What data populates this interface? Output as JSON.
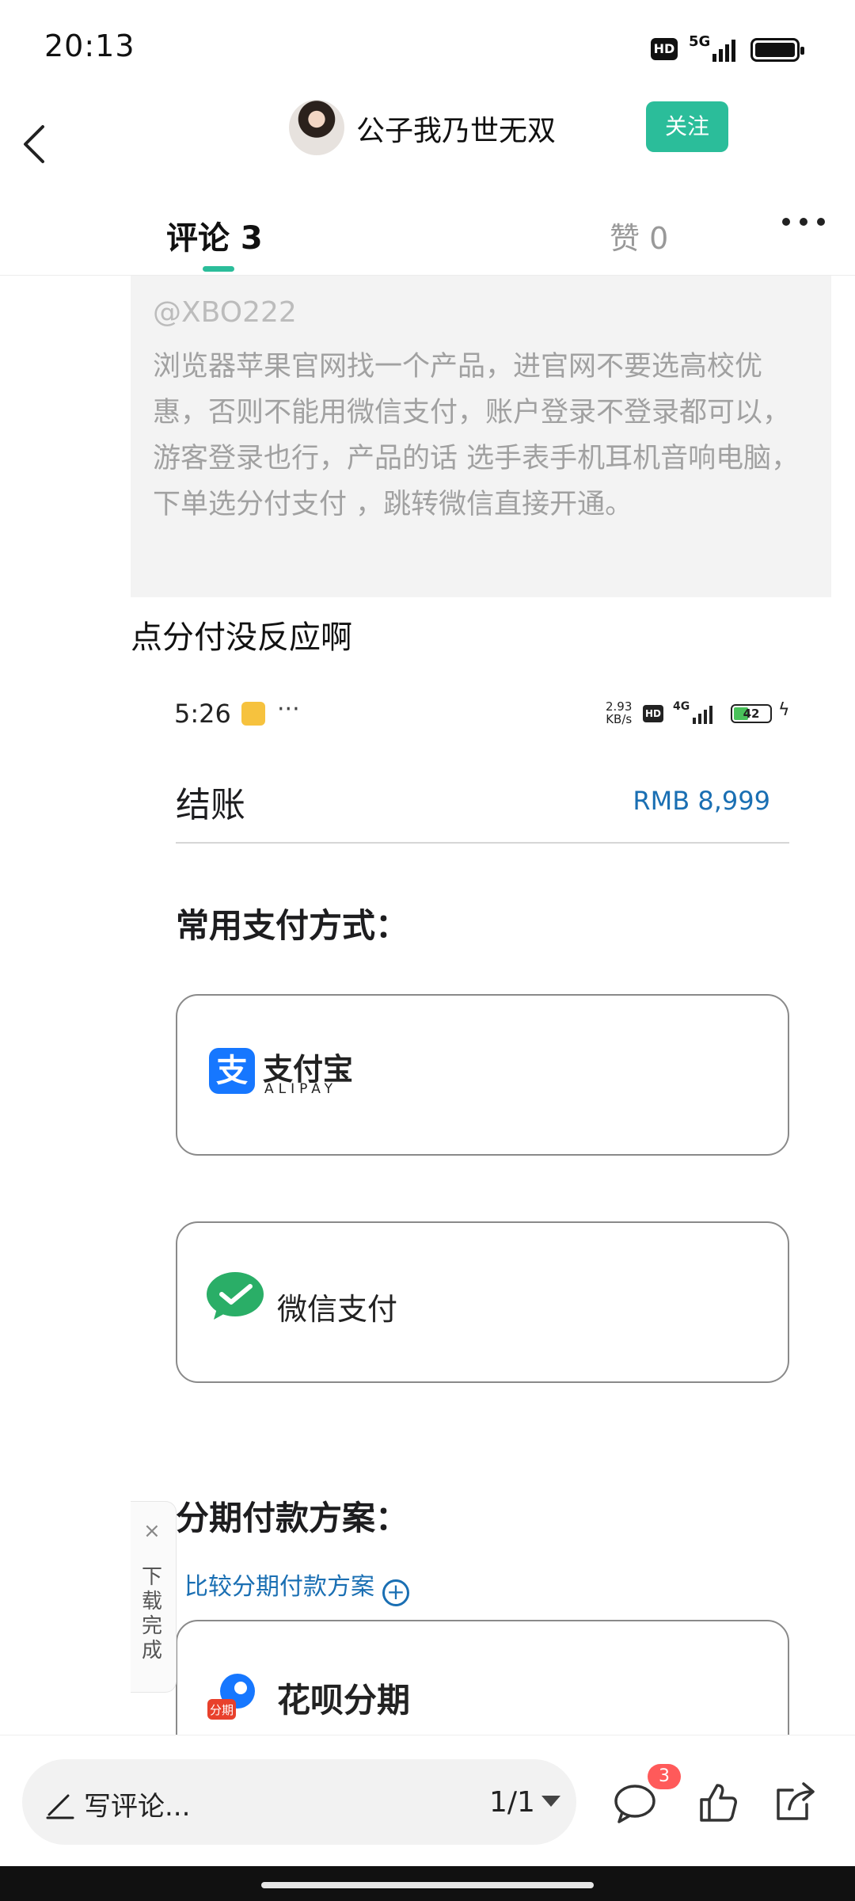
{
  "status_bar": {
    "time": "20:13",
    "hd": "HD",
    "network": "5G"
  },
  "header": {
    "author_name": "公子我乃世无双",
    "follow_label": "关注"
  },
  "tabs": {
    "comments_label": "评论 3",
    "likes_label": "赞 0"
  },
  "quoted_comment": {
    "user": "@XBO222",
    "text": "浏览器苹果官网找一个产品，进官网不要选高校优惠，否则不能用微信支付，账户登录不登录都可以，游客登录也行，产品的话 选手表手机耳机音响电脑，下单选分付支付 ，跳转微信直接开通。"
  },
  "reply_text": "点分付没反应啊",
  "embedded_screenshot": {
    "time": "5:26",
    "dots": "···",
    "speed_value": "2.93",
    "speed_unit": "KB/s",
    "hd": "HD",
    "network": "4G",
    "battery": "42",
    "checkout_title": "结账",
    "price": "RMB 8,999",
    "payment_heading": "常用支付方式：",
    "alipay_name": "支付宝",
    "alipay_sub": "ALIPAY",
    "alipay_glyph": "支",
    "wechat_pay_name": "微信支付",
    "installment_heading": "分期付款方案：",
    "compare_link": "比较分期付款方案",
    "compare_icon": "+",
    "huabei_name": "花呗分期",
    "huabei_glyph": "分期"
  },
  "download_toast": {
    "close": "×",
    "label": "下载完成"
  },
  "bottom_bar": {
    "comment_placeholder": "写评论...",
    "page_indicator": "1/1",
    "comment_count_badge": "3"
  },
  "colors": {
    "accent": "#2bbd9a",
    "link_blue": "#1a6fb3",
    "alipay_blue": "#1677ff",
    "wechat_green": "#2aae67",
    "badge_red": "#ff5a5a"
  },
  "icons": [
    "back-arrow-icon",
    "more-icon",
    "pen-icon",
    "chevron-down-icon",
    "comment-bubble-icon",
    "thumbs-up-icon",
    "share-icon",
    "alipay-logo-icon",
    "wechat-pay-logo-icon",
    "huabei-logo-icon",
    "add-circle-icon",
    "close-icon"
  ]
}
